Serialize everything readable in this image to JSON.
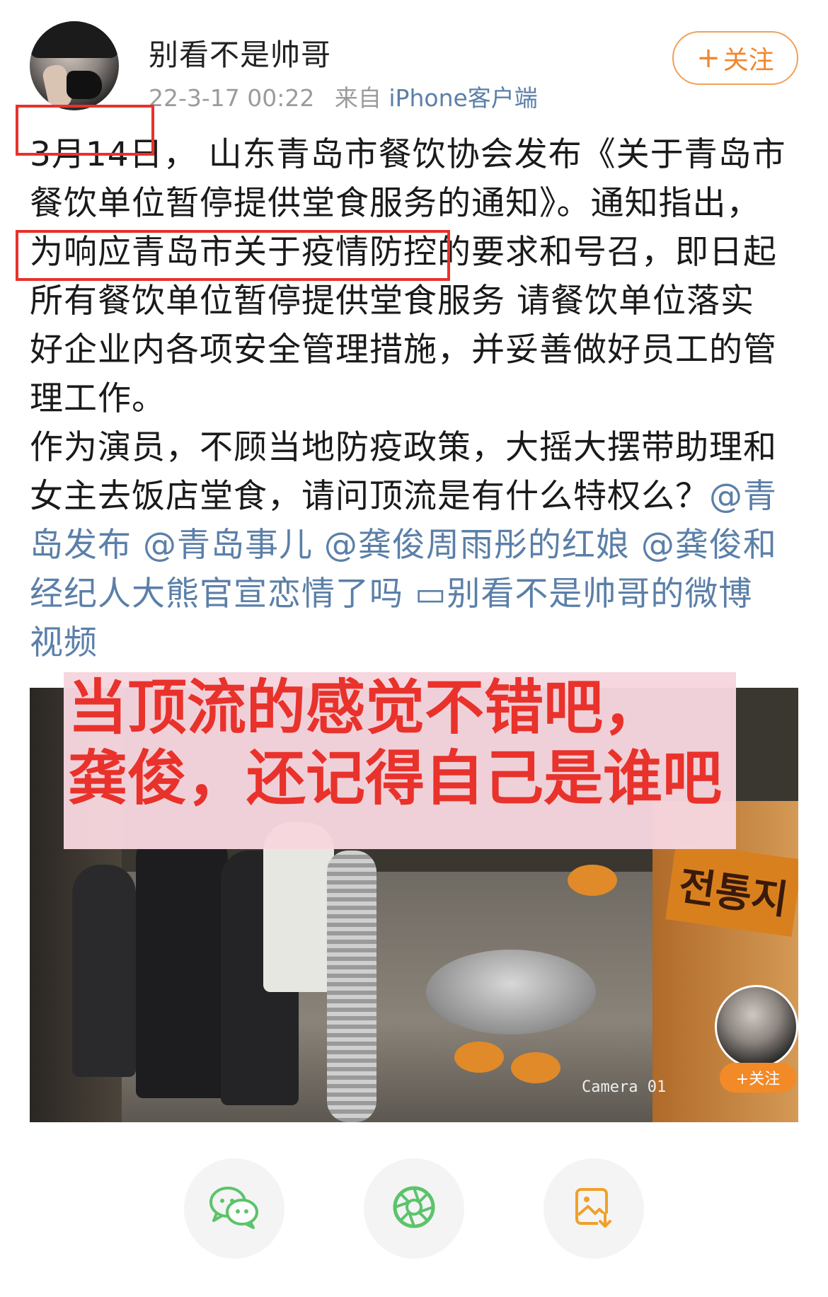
{
  "header": {
    "username": "别看不是帅哥",
    "timestamp": "22-3-17 00:22",
    "from_label": "来自",
    "source": "iPhone客户端",
    "follow_label": "关注",
    "follow_plus": "+"
  },
  "post": {
    "lines": [
      [
        {
          "t": "3月14日，",
          "c": "text",
          "hl": true
        },
        {
          "t": " 山东青岛市餐饮协会发布《关于青岛市",
          "c": "text"
        }
      ],
      [
        {
          "t": "餐饮单位暂停提供堂食服务的通知》。通知指出，",
          "c": "text"
        }
      ],
      [
        {
          "t": "为响应青岛市关于疫情防控的要求和号召，即日起",
          "c": "text"
        }
      ],
      [
        {
          "t": "所有餐饮单位暂停提供堂食服务",
          "c": "text",
          "hl": true
        },
        {
          "t": "   请餐饮单位落实",
          "c": "text"
        }
      ],
      [
        {
          "t": "好企业内各项安全管理措施，并妥善做好员工的管",
          "c": "text"
        }
      ],
      [
        {
          "t": "理工作。",
          "c": "text"
        }
      ],
      [
        {
          "t": "作为演员，不顾当地防疫政策，大摇大摆带助理和",
          "c": "text"
        }
      ],
      [
        {
          "t": "女主去饭店堂食，请问顶流是有什么特权么？",
          "c": "text"
        },
        {
          "t": "@青",
          "c": "mention"
        }
      ],
      [
        {
          "t": "岛发布 @青岛事儿 @龚俊周雨彤的红娘 @龚俊和",
          "c": "mention"
        }
      ],
      [
        {
          "t": "经纪人大熊官宣恋情了吗 ",
          "c": "mention"
        },
        {
          "t": "▭",
          "c": "mention"
        },
        {
          "t": "别看不是帅哥的微博",
          "c": "mention"
        }
      ],
      [
        {
          "t": "视频",
          "c": "mention"
        }
      ]
    ]
  },
  "video": {
    "caption_lines": [
      "当顶流的感觉不错吧，",
      "龚俊，还记得自己是谁吧"
    ],
    "sign_text": "전통지",
    "camera_label": "Camera 01",
    "mini_follow_label": "+关注"
  },
  "share": {
    "icons": [
      "wechat-icon",
      "moments-icon",
      "save-image-icon"
    ]
  },
  "colors": {
    "accent_orange": "#f0872e",
    "link_blue": "#5b7fa8",
    "highlight_red": "#e8322b",
    "caption_bg": "#f6d6de"
  }
}
